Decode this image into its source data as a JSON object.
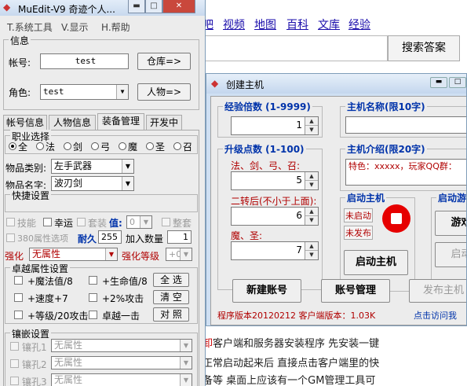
{
  "browser": {
    "nav_links": [
      "吧",
      "视频",
      "地图",
      "百科",
      "文库",
      "经验"
    ],
    "search_button": "搜索答案",
    "lines": [
      {
        "red": "卸",
        "text": "客户端和服务器安装程序 先安装一键"
      },
      {
        "red": "",
        "text": "正常启动起来后 直接点击客户端里的快"
      },
      {
        "red": "",
        "text": "备等 桌面上应该有一个GM管理工具可"
      }
    ]
  },
  "create_host": {
    "title": "创建主机",
    "exp_group": "经验倍数 (1-9999)",
    "exp_value": "1",
    "points_group": "升级点数 (1-100)",
    "points_label1": "法、剑、弓、召:",
    "points_value1": "5",
    "points_label2": "二转后(不小于上面):",
    "points_value2": "6",
    "points_label3": "魔、圣:",
    "points_value3": "7",
    "name_group": "主机名称(限10字)",
    "intro_group": "主机介绍(限20字)",
    "intro_text": "特色：xxxxx，玩家QQ群：",
    "start_group": "启动主机",
    "status_not_started": "未启动",
    "status_not_published": "未发布",
    "start_button": "启动主机",
    "game_group": "启动游戏",
    "game_button": "游戏设",
    "game_start_button": "启动游",
    "new_account_button": "新建账号",
    "account_manage_button": "账号管理",
    "publish_button": "发布主机",
    "version_text": "程序版本20120212 客户端版本：1.03K",
    "visit_link": "点击访问我"
  },
  "muedit": {
    "title": "MuEdit-V9  奇迹个人...",
    "menu": [
      "T.系统工具",
      "V.显示",
      "H.帮助"
    ],
    "info_group": "信息",
    "account_label": "帐号:",
    "account_value": "test",
    "warehouse_button": "仓库=>",
    "role_label": "角色:",
    "role_value": "test",
    "character_button": "人物=>",
    "tabs": [
      "帐号信息",
      "人物信息",
      "装备管理",
      "开发中"
    ],
    "job_group": "职业选择",
    "jobs": [
      "全",
      "法",
      "剑",
      "弓",
      "魔",
      "圣",
      "召"
    ],
    "item_type_label": "物品类别:",
    "item_type_value": "左手武器",
    "item_name_label": "物品名字:",
    "item_name_value": "波刃剑",
    "quick_group": "快捷设置",
    "skill_label": "技能",
    "luck_label": "幸运",
    "set_label": "套装",
    "value_label": "值:",
    "value_select": "0",
    "refine_label": "整套",
    "attr380_label": "380属性选项",
    "durability_label": "耐久",
    "durability_value": "255",
    "add_count_label": "加入数量",
    "add_count_value": "1",
    "enhance_label": "强化",
    "enhance_value": "无属性",
    "enhance_level_label": "强化等级",
    "enhance_level_value": "+0",
    "excellent_group": "卓越属性设置",
    "exc_opts": [
      "+魔法值/8",
      "+生命值/8",
      "+速度+7",
      "+2%攻击",
      "+等级/20攻击",
      "卓越一击"
    ],
    "select_all_button": "全 选",
    "clear_button": "清 空",
    "compare_button": "对 照",
    "socket_group": "镶嵌设置",
    "sockets": [
      {
        "label": "镶孔1",
        "value": "无属性"
      },
      {
        "label": "镶孔2",
        "value": "无属性"
      },
      {
        "label": "镶孔3",
        "value": "无属性"
      }
    ]
  }
}
